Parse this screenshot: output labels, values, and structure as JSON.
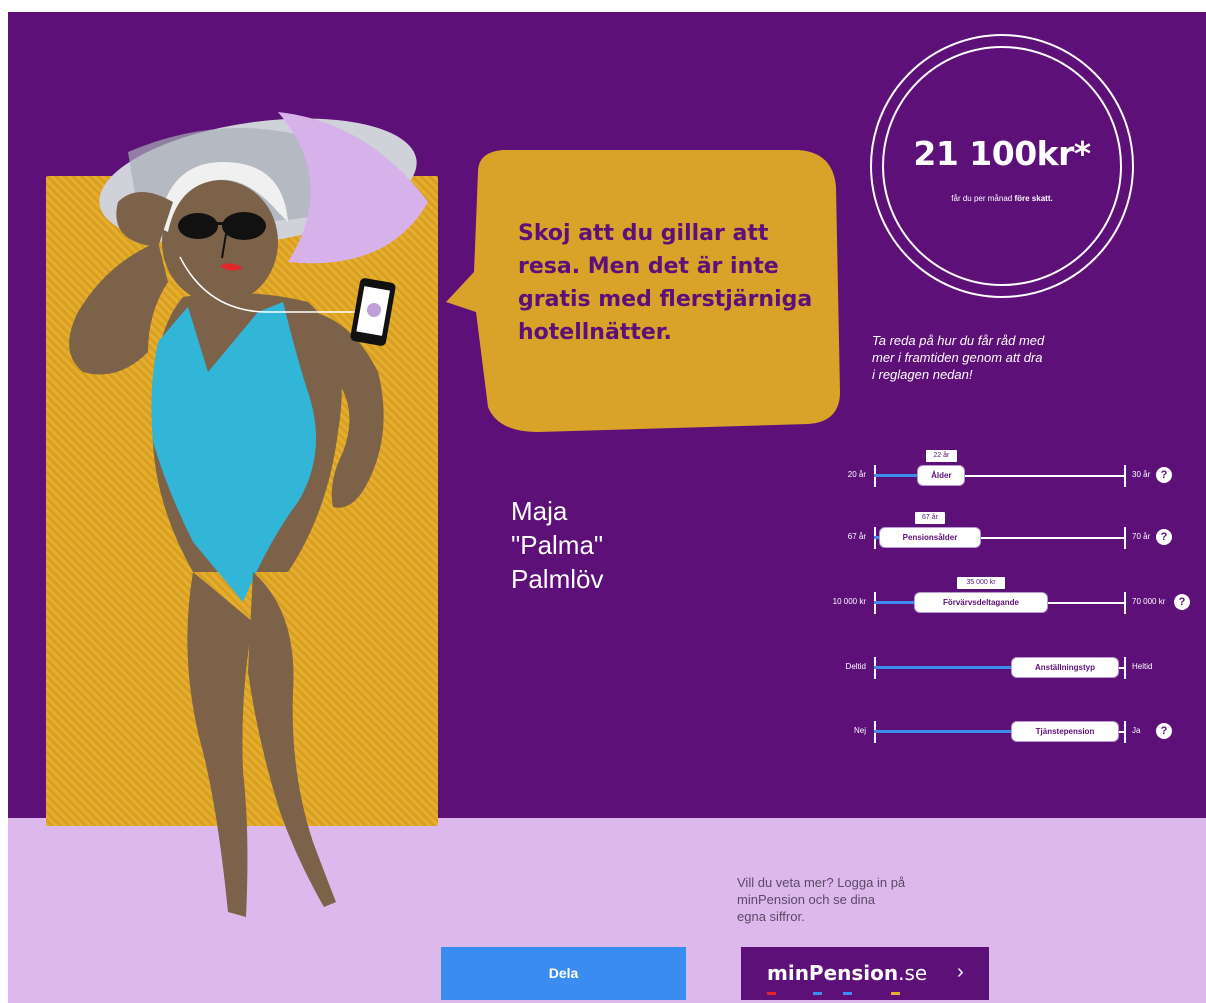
{
  "speech": {
    "text": "Skoj att du gillar att\nresa. Men det är inte\ngratis med flerstjärniga\nhotellnätter."
  },
  "persona": {
    "name": "Maja\n\"Palma\"\nPalmlöv"
  },
  "pension": {
    "amount": "21 100kr*",
    "sub_prefix": "får du per månad",
    "sub_bold": "före skatt."
  },
  "hint": "Ta reda på hur du får råd med\nmer i framtiden genom att dra\ni reglagen nedan!",
  "sliders": [
    {
      "label": "Ålder",
      "min": "20 år",
      "max": "30 år",
      "value": "22 år",
      "fraction": 0.2,
      "help": true
    },
    {
      "label": "Pensionsålder",
      "min": "67 år",
      "max": "70 år",
      "value": "67 år",
      "fraction": 0.0,
      "help": true
    },
    {
      "label": "Förvärvsdeltagande",
      "min": "10 000 kr",
      "max": "70 000 kr",
      "value": "35 000 kr",
      "fraction": 0.33,
      "help": true
    },
    {
      "label": "Anställningstyp",
      "min": "Deltid",
      "max": "Heltid",
      "value": "",
      "fraction": 1.0,
      "help": false
    },
    {
      "label": "Tjänstepension",
      "min": "Nej",
      "max": "Ja",
      "value": "",
      "fraction": 1.0,
      "help": true
    }
  ],
  "cta": {
    "text": "Vill du veta mer? Logga in på\nminPension och se dina\negna siffror."
  },
  "buttons": {
    "share": "Dela",
    "brand_main": "minPension",
    "brand_domain": ".se",
    "chevron": "›"
  },
  "icons": {
    "help": "?"
  },
  "colors": {
    "purple": "#5c1078",
    "lilac": "#ddb8ec",
    "blue": "#3a8cf0",
    "towel": "#e4ae2e",
    "swimsuit": "#31b6d8"
  }
}
